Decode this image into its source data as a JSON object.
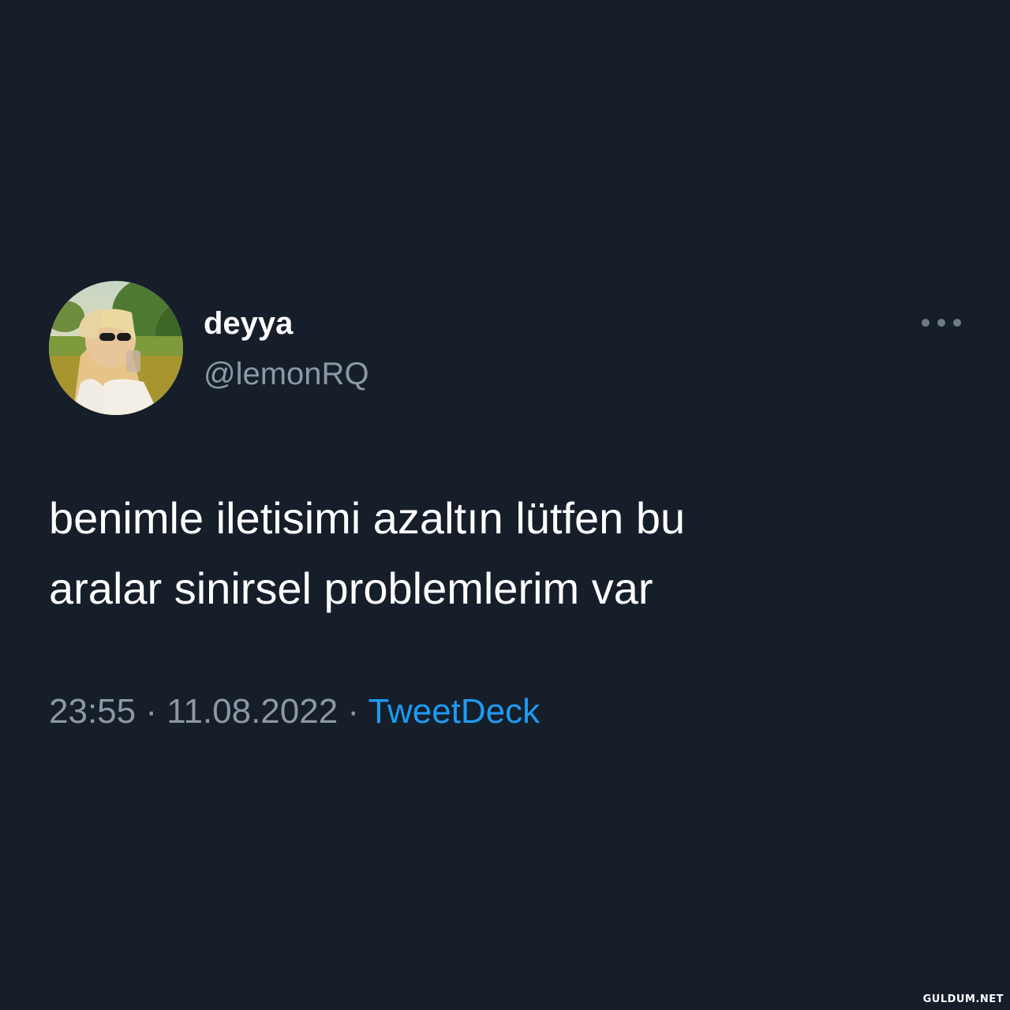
{
  "tweet": {
    "author": {
      "display_name": "deyya",
      "handle": "@lemonRQ",
      "avatar_icon": "profile-photo"
    },
    "more_icon": "more-horizontal-icon",
    "text_lines": [
      "benimle iletisimi azaltın lütfen bu",
      "aralar sinirsel problemlerim var"
    ],
    "time": "23:55",
    "separator": "·",
    "date": "11.08.2022",
    "source": "TweetDeck"
  },
  "watermark": "GULDUM.NET",
  "colors": {
    "background": "#161e2a",
    "primary_text": "#ffffff",
    "secondary_text": "#8b98a5",
    "link": "#1d9bf0"
  }
}
